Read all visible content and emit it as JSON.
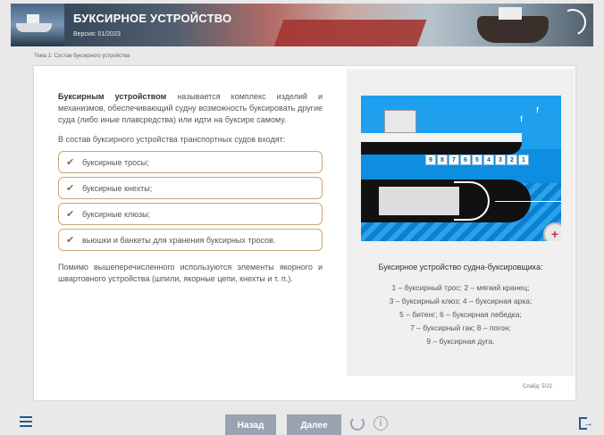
{
  "header": {
    "title": "БУКСИРНОЕ УСТРОЙСТВО",
    "version": "Версия: 01/2023"
  },
  "breadcrumb": "Тема 1: Состав буксирного устройства",
  "content": {
    "definition_term": "Буксирным устройством",
    "definition_rest": " называется комплекс изделий и механизмов, обеспечивающий судну возможность буксировать другие суда (либо иные плавсредства) или идти на буксире самому.",
    "includes_intro": "В состав буксирного устройства транспортных судов входят:",
    "items": [
      {
        "label": "буксирные тросы;"
      },
      {
        "label": "буксирные кнехты;"
      },
      {
        "label": "буксирные клюзы;"
      },
      {
        "label": "вьюшки и банкеты для хранения буксирных тросов."
      }
    ],
    "additional": "Помимо вышеперечисленного используются элементы якорного и швартовного устройства (шпили, якорные цепи, кнехты и т. п.)."
  },
  "figure": {
    "callout_numbers": [
      "9",
      "8",
      "7",
      "6",
      "5",
      "4",
      "3",
      "2",
      "1"
    ],
    "caption_title": "Буксирное устройство судна-буксировщика:",
    "legend_lines": [
      "1 – буксирный трос; 2 – мягкий кранец;",
      "3 – буксирный клюз; 4 – буксирная арка;",
      "5 – битенг; 6 – буксирная лебедка;",
      "7 – буксирный гак; 8 – погон;",
      "9 – буксирная дуга."
    ]
  },
  "slide_counter": "Слайд: 5/22",
  "nav": {
    "back_label": "Назад",
    "next_label": "Далее"
  },
  "icons": [
    "menu-icon",
    "check-icon",
    "zoom-icon",
    "reload-icon",
    "info-icon",
    "exit-icon"
  ]
}
